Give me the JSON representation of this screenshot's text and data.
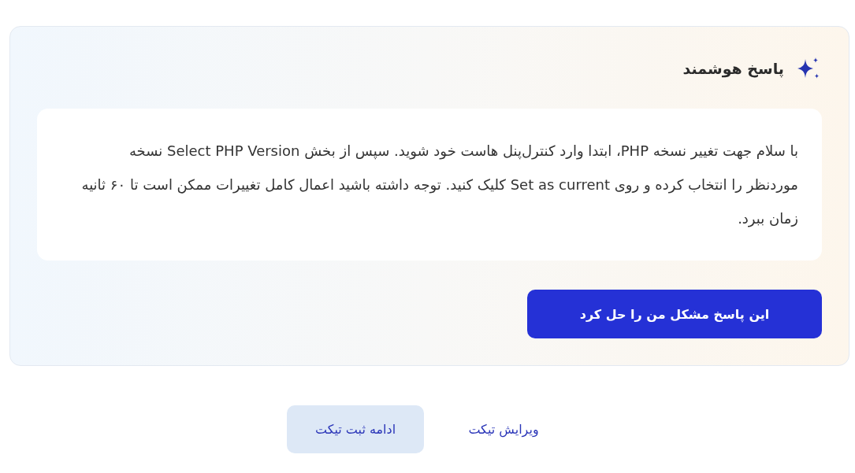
{
  "card": {
    "title": "پاسخ هوشمند",
    "answer": "با سلام جهت تغییر نسخه PHP، ابتدا وارد کنترل‌پنل هاست خود شوید. سپس از بخش Select PHP Version نسخه مورد‌نظر را انتخاب کرده و روی Set as current کلیک کنید. توجه داشته باشید اعمال کامل تغییرات ممکن است تا ۶۰ ثانیه زمان ببرد.",
    "button": "این پاسخ مشکل من را حل کرد"
  },
  "actions": [
    {
      "label": "ویرایش تیکت",
      "kind": "text"
    },
    {
      "label": "ادامه ثبت تیکت",
      "kind": "filled"
    }
  ]
}
